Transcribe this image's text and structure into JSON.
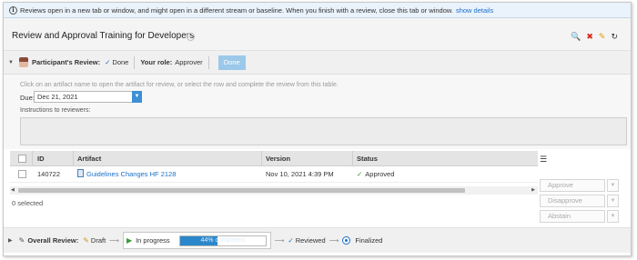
{
  "info_bar": {
    "message": "Reviews open in a new tab or window, and might open in a different stream or baseline. When you finish with a review, close this tab or window.",
    "link": "show details"
  },
  "header": {
    "title": "Review and Approval Training for Developers",
    "help_glyph": "?"
  },
  "participant": {
    "label": "Participant's Review:",
    "status": "Done",
    "role_label": "Your role:",
    "role": "Approver",
    "done_button": "Done"
  },
  "form": {
    "hint": "Click on an artifact name to open the artifact for review, or select the row and complete the review from this table.",
    "due_label": "Due:",
    "due_value": "Dec 21, 2021",
    "instructions_label": "Instructions to reviewers:",
    "instructions_value": ""
  },
  "table": {
    "columns": [
      "ID",
      "Artifact",
      "Version",
      "Status"
    ],
    "rows": [
      {
        "id": "140722",
        "artifact": "Guidelines Changes HF 2128",
        "version": "Nov 10, 2021 4:39 PM",
        "status": "Approved"
      }
    ]
  },
  "selection": {
    "text": "0 selected"
  },
  "actions": {
    "approve": "Approve",
    "disapprove": "Disapprove",
    "abstain": "Abstain"
  },
  "overall": {
    "label": "Overall Review:",
    "steps": {
      "draft": "Draft",
      "in_progress": "In progress",
      "reviewed": "Reviewed",
      "finalized": "Finalized"
    },
    "progress_percent": 44,
    "progress_text": "44% completed"
  },
  "colors": {
    "accent": "#1a6fc9",
    "progress": "#2b87c9",
    "done_button": "#9cc8e9",
    "approved_check": "#3a8f2a",
    "delete_icon": "#d9261c"
  }
}
